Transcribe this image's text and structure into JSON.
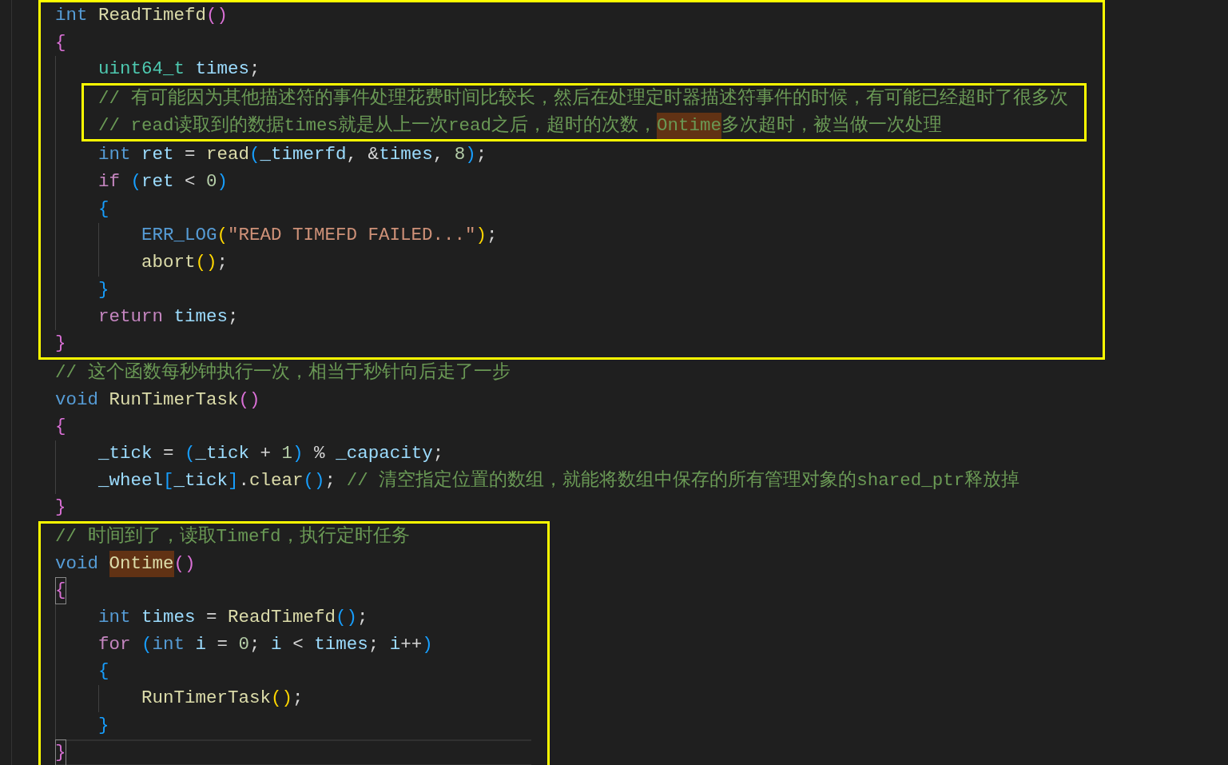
{
  "editor": {
    "items": [
      {
        "kind": "box",
        "items": [
          {
            "kind": "line",
            "cursor": false,
            "tokens": [
              {
                "text": "int ",
                "kind": "keyword"
              },
              {
                "text": "ReadTimefd",
                "kind": "function"
              },
              {
                "text": "()",
                "kind": "bracket1"
              }
            ]
          },
          {
            "kind": "line",
            "cursor": false,
            "tokens": [
              {
                "text": "{",
                "kind": "bracket1"
              }
            ],
            "children": [
              {
                "kind": "line",
                "cursor": false,
                "tokens": [
                  {
                    "text": "uint64_t ",
                    "kind": "type"
                  },
                  {
                    "text": "times",
                    "kind": "variable"
                  },
                  {
                    "text": ";",
                    "kind": "plain"
                  }
                ]
              },
              {
                "kind": "box",
                "items": [
                  {
                    "kind": "line",
                    "cursor": false,
                    "tokens": [
                      {
                        "text": "// 有可能因为其他描述符的事件处理花费时间比较长，然后在处理定时器描述符事件的时候，有可能已经超时了很多次",
                        "kind": "comment"
                      }
                    ]
                  },
                  {
                    "kind": "line",
                    "cursor": false,
                    "tokens": [
                      {
                        "text": "// read读取到的数据times就是从上一次read之后，超时的次数，",
                        "kind": "comment"
                      },
                      {
                        "text": "Ontime",
                        "kind": "comment_highlight"
                      },
                      {
                        "text": "多次超时，被当做一次处理",
                        "kind": "comment"
                      }
                    ]
                  }
                ]
              },
              {
                "kind": "line",
                "cursor": false,
                "tokens": [
                  {
                    "text": "int ",
                    "kind": "keyword"
                  },
                  {
                    "text": "ret",
                    "kind": "variable"
                  },
                  {
                    "text": " = ",
                    "kind": "plain"
                  },
                  {
                    "text": "read",
                    "kind": "function"
                  },
                  {
                    "text": "(",
                    "kind": "bracket2"
                  },
                  {
                    "text": "_timerfd",
                    "kind": "variable"
                  },
                  {
                    "text": ", &",
                    "kind": "plain"
                  },
                  {
                    "text": "times",
                    "kind": "variable"
                  },
                  {
                    "text": ", ",
                    "kind": "plain"
                  },
                  {
                    "text": "8",
                    "kind": "number"
                  },
                  {
                    "text": ")",
                    "kind": "bracket2"
                  },
                  {
                    "text": ";",
                    "kind": "plain"
                  }
                ]
              },
              {
                "kind": "line",
                "cursor": false,
                "tokens": [
                  {
                    "text": "if ",
                    "kind": "control"
                  },
                  {
                    "text": "(",
                    "kind": "bracket2"
                  },
                  {
                    "text": "ret",
                    "kind": "variable"
                  },
                  {
                    "text": " < ",
                    "kind": "plain"
                  },
                  {
                    "text": "0",
                    "kind": "number"
                  },
                  {
                    "text": ")",
                    "kind": "bracket2"
                  }
                ]
              },
              {
                "kind": "line",
                "cursor": false,
                "tokens": [
                  {
                    "text": "{",
                    "kind": "bracket2"
                  }
                ],
                "children": [
                  {
                    "kind": "line",
                    "cursor": false,
                    "tokens": [
                      {
                        "text": "ERR_LOG",
                        "kind": "keyword"
                      },
                      {
                        "text": "(",
                        "kind": "bracket3"
                      },
                      {
                        "text": "\"READ TIMEFD FAILED...\"",
                        "kind": "string"
                      },
                      {
                        "text": ")",
                        "kind": "bracket3"
                      },
                      {
                        "text": ";",
                        "kind": "plain"
                      }
                    ]
                  },
                  {
                    "kind": "line",
                    "cursor": false,
                    "tokens": [
                      {
                        "text": "abort",
                        "kind": "function"
                      },
                      {
                        "text": "()",
                        "kind": "bracket3"
                      },
                      {
                        "text": ";",
                        "kind": "plain"
                      }
                    ]
                  }
                ]
              },
              {
                "kind": "line",
                "cursor": false,
                "tokens": [
                  {
                    "text": "}",
                    "kind": "bracket2"
                  }
                ]
              },
              {
                "kind": "line",
                "cursor": false,
                "tokens": [
                  {
                    "text": "return ",
                    "kind": "control"
                  },
                  {
                    "text": "times",
                    "kind": "variable"
                  },
                  {
                    "text": ";",
                    "kind": "plain"
                  }
                ]
              }
            ]
          },
          {
            "kind": "line",
            "cursor": false,
            "tokens": [
              {
                "text": "}",
                "kind": "bracket1"
              }
            ]
          }
        ]
      },
      {
        "kind": "line",
        "cursor": false,
        "tokens": [
          {
            "text": "// 这个函数每秒钟执行一次，相当于秒针向后走了一步",
            "kind": "comment"
          }
        ]
      },
      {
        "kind": "line",
        "cursor": false,
        "tokens": [
          {
            "text": "void ",
            "kind": "keyword"
          },
          {
            "text": "RunTimerTask",
            "kind": "function"
          },
          {
            "text": "()",
            "kind": "bracket1"
          }
        ]
      },
      {
        "kind": "line",
        "cursor": false,
        "tokens": [
          {
            "text": "{",
            "kind": "bracket1"
          }
        ],
        "children": [
          {
            "kind": "line",
            "cursor": false,
            "tokens": [
              {
                "text": "_tick",
                "kind": "variable"
              },
              {
                "text": " = ",
                "kind": "plain"
              },
              {
                "text": "(",
                "kind": "bracket2"
              },
              {
                "text": "_tick",
                "kind": "variable"
              },
              {
                "text": " + ",
                "kind": "plain"
              },
              {
                "text": "1",
                "kind": "number"
              },
              {
                "text": ")",
                "kind": "bracket2"
              },
              {
                "text": " % ",
                "kind": "plain"
              },
              {
                "text": "_capacity",
                "kind": "variable"
              },
              {
                "text": ";",
                "kind": "plain"
              }
            ]
          },
          {
            "kind": "line",
            "cursor": false,
            "tokens": [
              {
                "text": "_wheel",
                "kind": "variable"
              },
              {
                "text": "[",
                "kind": "bracket2"
              },
              {
                "text": "_tick",
                "kind": "variable"
              },
              {
                "text": "]",
                "kind": "bracket2"
              },
              {
                "text": ".",
                "kind": "plain"
              },
              {
                "text": "clear",
                "kind": "function"
              },
              {
                "text": "()",
                "kind": "bracket2"
              },
              {
                "text": "; ",
                "kind": "plain"
              },
              {
                "text": "// 清空指定位置的数组，就能将数组中保存的所有管理对象的shared_ptr释放掉",
                "kind": "comment"
              }
            ]
          }
        ]
      },
      {
        "kind": "line",
        "cursor": false,
        "tokens": [
          {
            "text": "}",
            "kind": "bracket1"
          }
        ]
      },
      {
        "kind": "box",
        "items": [
          {
            "kind": "line",
            "cursor": false,
            "tokens": [
              {
                "text": "// 时间到了，读取Timefd，执行定时任务",
                "kind": "comment"
              }
            ]
          },
          {
            "kind": "line",
            "cursor": false,
            "tokens": [
              {
                "text": "void ",
                "kind": "keyword"
              },
              {
                "text": "Ontime",
                "kind": "function_highlight"
              },
              {
                "text": "()",
                "kind": "bracket1"
              }
            ]
          },
          {
            "kind": "line",
            "cursor": false,
            "tokens": [
              {
                "text": "{",
                "kind": "bracket1_match"
              }
            ],
            "children": [
              {
                "kind": "line",
                "cursor": false,
                "tokens": [
                  {
                    "text": "int ",
                    "kind": "keyword"
                  },
                  {
                    "text": "times",
                    "kind": "variable"
                  },
                  {
                    "text": " = ",
                    "kind": "plain"
                  },
                  {
                    "text": "ReadTimefd",
                    "kind": "function"
                  },
                  {
                    "text": "()",
                    "kind": "bracket2"
                  },
                  {
                    "text": ";",
                    "kind": "plain"
                  }
                ]
              },
              {
                "kind": "line",
                "cursor": false,
                "tokens": [
                  {
                    "text": "for ",
                    "kind": "control"
                  },
                  {
                    "text": "(",
                    "kind": "bracket2"
                  },
                  {
                    "text": "int ",
                    "kind": "keyword"
                  },
                  {
                    "text": "i",
                    "kind": "variable"
                  },
                  {
                    "text": " = ",
                    "kind": "plain"
                  },
                  {
                    "text": "0",
                    "kind": "number"
                  },
                  {
                    "text": "; ",
                    "kind": "plain"
                  },
                  {
                    "text": "i",
                    "kind": "variable"
                  },
                  {
                    "text": " < ",
                    "kind": "plain"
                  },
                  {
                    "text": "times",
                    "kind": "variable"
                  },
                  {
                    "text": "; ",
                    "kind": "plain"
                  },
                  {
                    "text": "i",
                    "kind": "variable"
                  },
                  {
                    "text": "++",
                    "kind": "plain"
                  },
                  {
                    "text": ")",
                    "kind": "bracket2"
                  }
                ]
              },
              {
                "kind": "line",
                "cursor": false,
                "tokens": [
                  {
                    "text": "{",
                    "kind": "bracket2"
                  }
                ],
                "children": [
                  {
                    "kind": "line",
                    "cursor": false,
                    "tokens": [
                      {
                        "text": "RunTimerTask",
                        "kind": "function"
                      },
                      {
                        "text": "()",
                        "kind": "bracket3"
                      },
                      {
                        "text": ";",
                        "kind": "plain"
                      }
                    ]
                  }
                ]
              },
              {
                "kind": "line",
                "cursor": false,
                "tokens": [
                  {
                    "text": "}",
                    "kind": "bracket2"
                  }
                ]
              }
            ]
          },
          {
            "kind": "line",
            "cursor": true,
            "tokens": [
              {
                "text": "}",
                "kind": "bracket1_match"
              }
            ]
          }
        ]
      }
    ]
  }
}
